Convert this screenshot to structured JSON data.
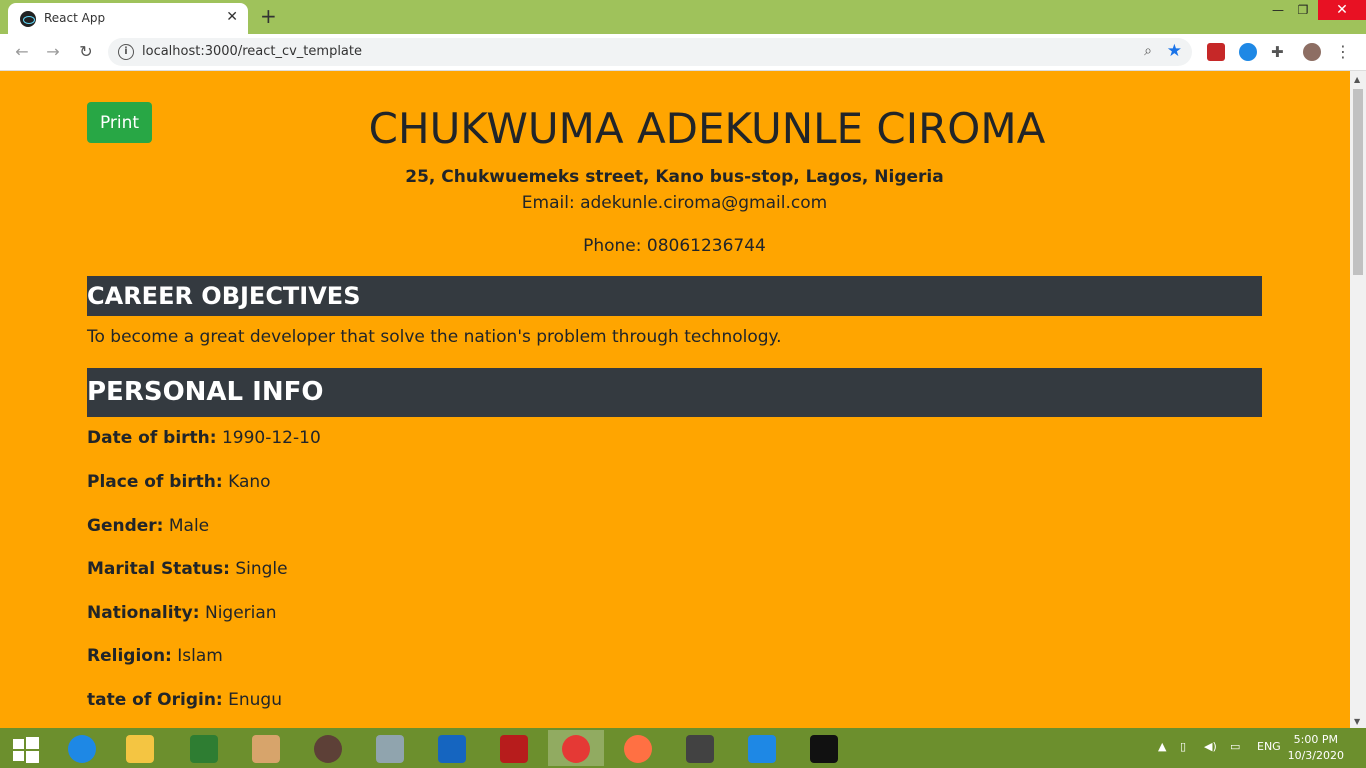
{
  "browser": {
    "tab_title": "React App",
    "tab_close": "✕",
    "new_tab": "+",
    "url": "localhost:3000/react_cv_template",
    "window_controls": {
      "minimize": "—",
      "restore": "❐",
      "close": "✕"
    },
    "nav": {
      "back": "←",
      "forward": "→",
      "reload": "↻"
    }
  },
  "page": {
    "print_label": "Print",
    "name": "CHUKWUMA ADEKUNLE CIROMA",
    "address": "25, Chukwuemeks street, Kano bus-stop, Lagos, Nigeria",
    "email": "Email: adekunle.ciroma@gmail.com",
    "phone": "Phone: 08061236744",
    "career_heading": "CAREER OBJECTIVES",
    "career_text": "To become a great developer that solve the nation's problem through technology.",
    "personal_heading": "PERSONAL INFO",
    "personal_info": [
      {
        "label": "Date of birth:",
        "value": "1990-12-10"
      },
      {
        "label": "Place of birth:",
        "value": "Kano"
      },
      {
        "label": "Gender:",
        "value": "Male"
      },
      {
        "label": "Marital Status:",
        "value": "Single"
      },
      {
        "label": "Nationality:",
        "value": "Nigerian"
      },
      {
        "label": "Religion:",
        "value": "Islam"
      },
      {
        "label": "tate of Origin:",
        "value": "Enugu"
      }
    ]
  },
  "taskbar": {
    "language": "ENG",
    "time": "5:00 PM",
    "date": "10/3/2020"
  },
  "colors": {
    "page_bg": "#ffa500",
    "section_bg": "#343a40",
    "print_button": "#28a745",
    "tabbar": "#9fc25b",
    "taskbar": "#6c8f2d"
  }
}
